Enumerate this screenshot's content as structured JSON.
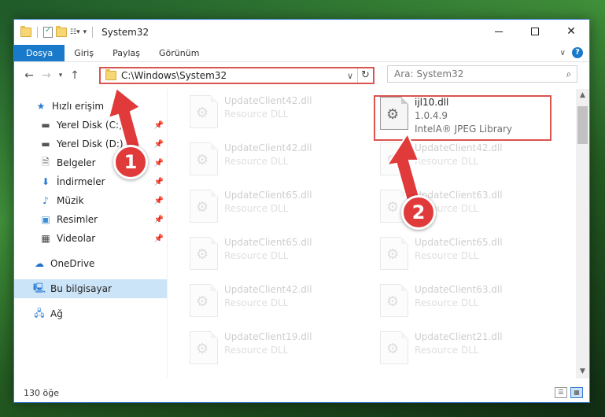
{
  "window": {
    "title": "System32"
  },
  "ribbon": {
    "tabs": [
      "Dosya",
      "Giriş",
      "Paylaş",
      "Görünüm"
    ]
  },
  "navbar": {
    "address_value": "C:\\Windows\\System32",
    "search_placeholder": "Ara: System32"
  },
  "sidebar": {
    "items": [
      {
        "label": "Hızlı erişim",
        "icon": "star-icon"
      },
      {
        "label": "Yerel Disk (C:)",
        "icon": "drive-icon",
        "pinned": true
      },
      {
        "label": "Yerel Disk (D:)",
        "icon": "drive-icon",
        "pinned": true
      },
      {
        "label": "Belgeler",
        "icon": "documents-icon",
        "pinned": true
      },
      {
        "label": "İndirmeler",
        "icon": "download-icon",
        "pinned": true
      },
      {
        "label": "Müzik",
        "icon": "music-icon",
        "pinned": true
      },
      {
        "label": "Resimler",
        "icon": "pictures-icon",
        "pinned": true
      },
      {
        "label": "Videolar",
        "icon": "videos-icon",
        "pinned": true
      },
      {
        "label": "OneDrive",
        "icon": "cloud-icon"
      },
      {
        "label": "Bu bilgisayar",
        "icon": "computer-icon",
        "selected": true
      },
      {
        "label": "Ağ",
        "icon": "network-icon"
      }
    ]
  },
  "files": [
    {
      "name": "UpdateClient42.dll",
      "sub": "Resource DLL"
    },
    {
      "name": "ijl10.dll",
      "version": "1.0.4.9",
      "description": "IntelA® JPEG Library",
      "highlighted": true
    },
    {
      "name": "UpdateClient42.dll",
      "sub": "Resource DLL"
    },
    {
      "name": "UpdateClient42.dll",
      "sub": "Resource DLL"
    },
    {
      "name": "UpdateClient65.dll",
      "sub": "Resource DLL"
    },
    {
      "name": "UpdateClient63.dll",
      "sub": "Resource DLL"
    },
    {
      "name": "UpdateClient65.dll",
      "sub": "Resource DLL"
    },
    {
      "name": "UpdateClient65.dll",
      "sub": "Resource DLL"
    },
    {
      "name": "UpdateClient42.dll",
      "sub": "Resource DLL"
    },
    {
      "name": "UpdateClient63.dll",
      "sub": "Resource DLL"
    },
    {
      "name": "UpdateClient19.dll",
      "sub": "Resource DLL"
    },
    {
      "name": "UpdateClient21.dll",
      "sub": "Resource DLL"
    }
  ],
  "statusbar": {
    "count": "130 öğe"
  },
  "annotations": {
    "badge1": "1",
    "badge2": "2",
    "color": "#e03a3a"
  }
}
